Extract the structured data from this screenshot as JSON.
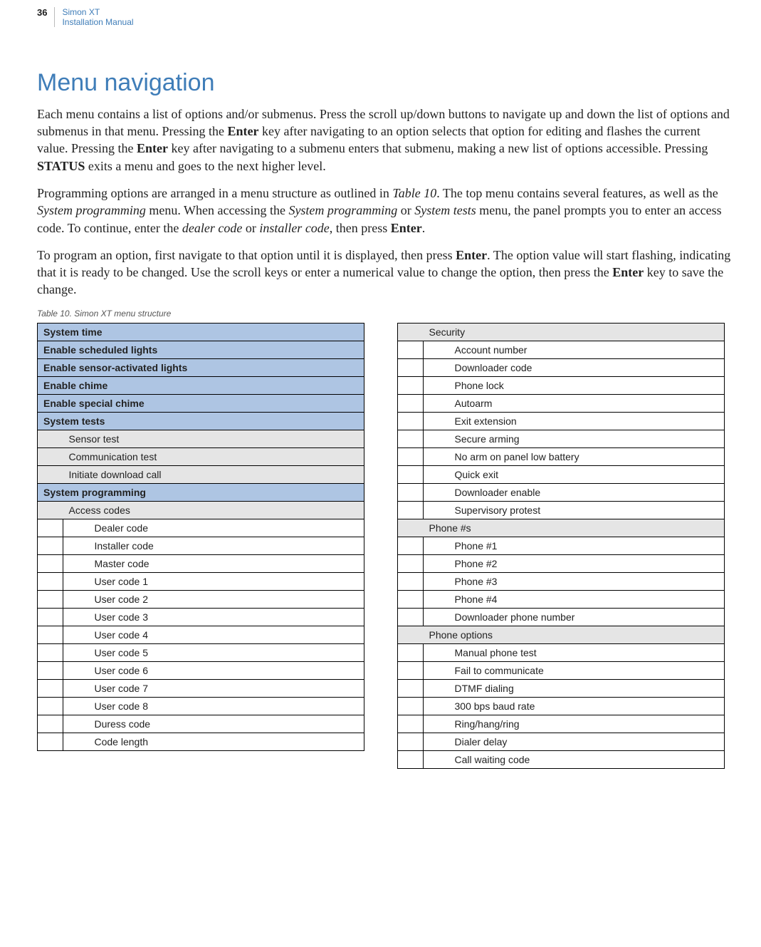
{
  "header": {
    "page_number": "36",
    "title": "Simon XT",
    "subtitle": "Installation Manual"
  },
  "heading": "Menu navigation",
  "paragraphs": {
    "p1_a": "Each menu contains a list of options and/or submenus. Press the scroll up/down buttons to navigate up and down the list of options and submenus in that menu. Pressing the ",
    "p1_b": "Enter",
    "p1_c": " key after navigating to an option selects that option for editing and flashes the current value. Pressing the ",
    "p1_d": "Enter",
    "p1_e": " key after navigating to a submenu enters that submenu, making a new list of options accessible. Pressing ",
    "p1_f": "STATUS",
    "p1_g": " exits a menu and goes to the next higher level.",
    "p2_a": "Programming options are arranged in a menu structure as outlined in ",
    "p2_b": "Table 10",
    "p2_c": ".  The top menu contains several features, as well as the ",
    "p2_d": "System programming",
    "p2_e": " menu. When accessing the ",
    "p2_f": "System programming",
    "p2_g": " or ",
    "p2_h": "System tests",
    "p2_i": " menu, the panel prompts you to enter an access code. To continue, enter the ",
    "p2_j": "dealer code",
    "p2_k": " or ",
    "p2_l": "installer code",
    "p2_m": ", then press ",
    "p2_n": "Enter",
    "p2_o": ".",
    "p3_a": "To program an option, first navigate to that option until it is displayed, then press ",
    "p3_b": "Enter",
    "p3_c": ". The option value will start flashing, indicating that it is ready to be changed. Use the scroll keys or enter a numerical value to change the option, then press the ",
    "p3_d": "Enter",
    "p3_e": " key to save the change."
  },
  "table_caption": "Table 10.   Simon XT  menu structure",
  "left": {
    "r1": "System time",
    "r2": "Enable scheduled lights",
    "r3": "Enable sensor-activated lights",
    "r4": "Enable chime",
    "r5": "Enable special chime",
    "r6": "System tests",
    "r7": "Sensor test",
    "r8": "Communication test",
    "r9": "Initiate download call",
    "r10": "System programming",
    "r11": "Access codes",
    "r12": "Dealer code",
    "r13": "Installer code",
    "r14": "Master code",
    "r15": "User code 1",
    "r16": "User code 2",
    "r17": "User code 3",
    "r18": "User code 4",
    "r19": "User code 5",
    "r20": "User code 6",
    "r21": "User code 7",
    "r22": "User code 8",
    "r23": "Duress code",
    "r24": "Code length"
  },
  "right": {
    "r1": "Security",
    "r2": "Account number",
    "r3": "Downloader code",
    "r4": "Phone lock",
    "r5": "Autoarm",
    "r6": "Exit extension",
    "r7": "Secure arming",
    "r8": "No arm on panel low battery",
    "r9": "Quick exit",
    "r10": "Downloader enable",
    "r11": "Supervisory protest",
    "r12": "Phone #s",
    "r13": "Phone #1",
    "r14": "Phone #2",
    "r15": "Phone #3",
    "r16": "Phone #4",
    "r17": "Downloader phone number",
    "r18": "Phone options",
    "r19": "Manual phone test",
    "r20": "Fail to communicate",
    "r21": "DTMF dialing",
    "r22": "300 bps baud rate",
    "r23": "Ring/hang/ring",
    "r24": "Dialer delay",
    "r25": "Call waiting code"
  }
}
